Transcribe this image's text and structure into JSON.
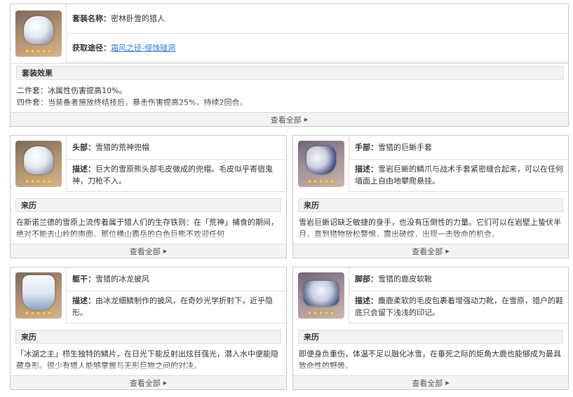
{
  "set": {
    "name_label": "套装名称：",
    "name_value": "密林卧雪的猎人",
    "source_label": "获取途径：",
    "source_link": "霜风之径-侵蚀隧洞",
    "effect_title": "套装效果",
    "effect_line1": "二件套：冰属性伤害提高10%。",
    "effect_line2": "四件套：当装备者施放终结技后，暴击伤害提高25%，持续2回合。",
    "more": "查看全部"
  },
  "pieces": [
    {
      "slot_label": "头部：",
      "slot_value": "雪猎的荒神兜帽",
      "desc_label": "描述：",
      "desc_value": "巨大的雪原熊头部毛皮做成的兜帽。毛皮似乎寄宿鬼神，刀枪不入。",
      "lore_title": "来历",
      "lore_text": "在斯诺兰德的雪原上流传着属于猎人们的生存铁则：在「荒神」捕食的期间，绝对不能去山岭的南面。那位横山霸岳的白色巨熊不欢迎任何",
      "more": "查看全部",
      "icon": "hood-icon"
    },
    {
      "slot_label": "手部：",
      "slot_value": "雪猎的巨蜥手套",
      "desc_label": "描述：",
      "desc_value": "雪岩巨蜥的鳞爪与战术手套紧密缝合起来，可以在任何墙面上自由地攀爬悬挂。",
      "lore_title": "来历",
      "lore_text": "雪岩巨蜥诏缺乏敏捷的身手，也没有压倒性的力量。它们可以在岩壁上蛰伏半月，直到猎物放松警惕，露出破绽，出现一击致命的机会。",
      "more": "查看全部",
      "icon": "glove-icon"
    },
    {
      "slot_label": "躯干：",
      "slot_value": "雪猎的冰龙披风",
      "desc_label": "描述：",
      "desc_value": "由冰龙细鳞制作的披风，在奇妙光学折射下，近乎隐形。",
      "lore_title": "来历",
      "lore_text": "「冰湖之主」栉生独特的鳞片，在日光下能反射出炫目强光，潜入水中便能隐藏身形。很少有猎人能够掌握与无形巨物之间的对决。",
      "more": "查看全部",
      "icon": "cape-icon"
    },
    {
      "slot_label": "脚部：",
      "slot_value": "雪猎的鹿皮软靴",
      "desc_label": "描述：",
      "desc_value": "麋鹿柔软的毛皮包裹着增强动力靴，在雪原，猎户的鞋底只会留下浅浅的印记。",
      "lore_title": "来历",
      "lore_text": "即便身负重伤，体温不足以融化冰雪，在垂死之际的炬角大鹿也能够成为最具致命性的野兽。",
      "more": "查看全部",
      "icon": "boots-icon"
    }
  ],
  "stars": "★★★★★"
}
